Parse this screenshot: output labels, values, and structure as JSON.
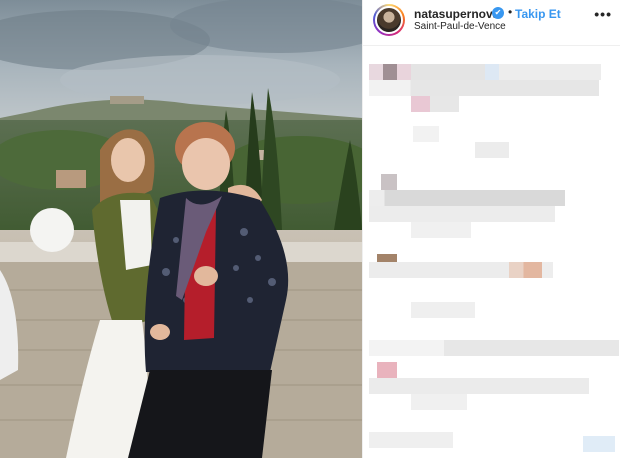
{
  "post": {
    "username": "natasupernova",
    "verified_icon": "verified-badge-icon",
    "verified_glyph": "✔",
    "separator": "•",
    "follow_label": "Takip Et",
    "location": "Saint-Paul-de-Vence",
    "more_label": "•••"
  },
  "colors": {
    "link_blue": "#3897f0",
    "text": "#262626",
    "border": "#efefef"
  }
}
